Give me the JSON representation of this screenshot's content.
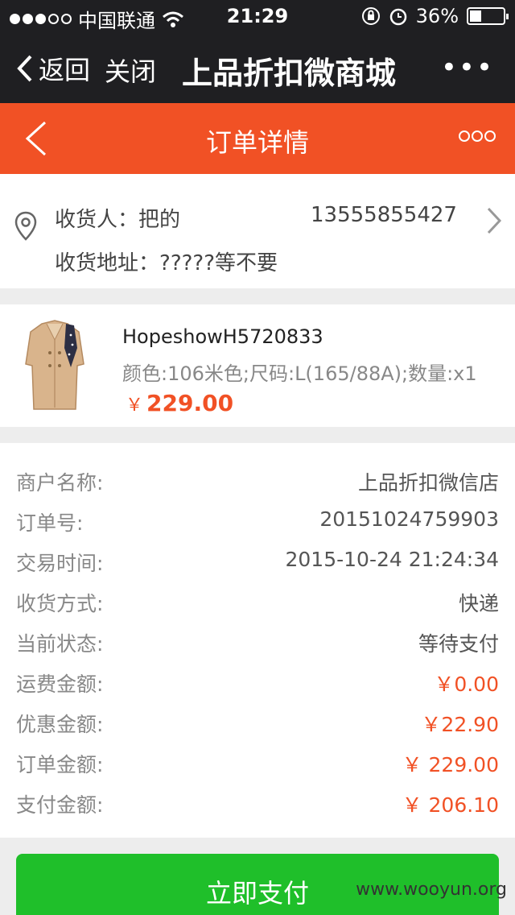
{
  "status_bar": {
    "carrier": "中国联通",
    "time": "21:29",
    "battery": "36%",
    "battery_level": 0.36
  },
  "wechat_nav": {
    "back_label": "返回",
    "close_label": "关闭",
    "title": "上品折扣微商城",
    "more": "•••"
  },
  "header": {
    "title": "订单详情"
  },
  "address": {
    "recipient_label": "收货人：",
    "recipient_name": "把的",
    "phone": "13555855427",
    "address_label": "收货地址：",
    "address_value": "?????等不要"
  },
  "product": {
    "name": "HopeshowH5720833",
    "spec": "颜色:106米色;尺码:L(165/88A);数量:x1",
    "currency": "￥",
    "price": "229.00"
  },
  "details": [
    {
      "label": "商户名称:",
      "value": "上品折扣微信店",
      "highlight": false
    },
    {
      "label": "订单号:",
      "value": "20151024759903",
      "highlight": false
    },
    {
      "label": "交易时间:",
      "value": "2015-10-24 21:24:34",
      "highlight": false
    },
    {
      "label": "收货方式:",
      "value": "快递",
      "highlight": false
    },
    {
      "label": "当前状态:",
      "value": "等待支付",
      "highlight": false
    },
    {
      "label": "运费金额:",
      "value": "￥0.00",
      "highlight": true
    },
    {
      "label": "优惠金额:",
      "value": "￥22.90",
      "highlight": true
    },
    {
      "label": "订单金额:",
      "value": "￥ 229.00",
      "highlight": true
    },
    {
      "label": "支付金额:",
      "value": "￥ 206.10",
      "highlight": true
    }
  ],
  "pay_button": "立即支付",
  "watermark": "www.wooyun.org",
  "colors": {
    "accent": "#f15125",
    "pay_green": "#1fbf2a",
    "nav_dark": "#1f1f22"
  }
}
